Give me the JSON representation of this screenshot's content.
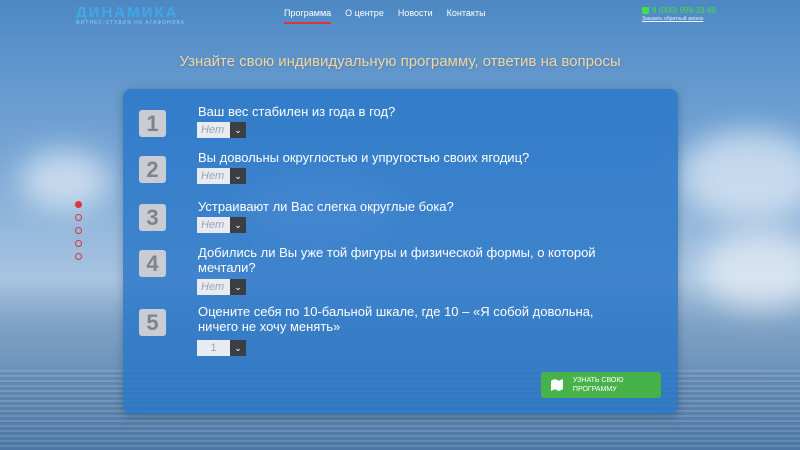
{
  "header": {
    "logo": {
      "title": "ДИНАМИКА",
      "subtitle": "ФИТНЕС-СТУДИЯ НА АГАФОНОВА"
    },
    "nav": [
      {
        "label": "Программа",
        "active": true
      },
      {
        "label": "О центре",
        "active": false
      },
      {
        "label": "Новости",
        "active": false
      },
      {
        "label": "Контакты",
        "active": false
      }
    ],
    "contact": {
      "phone": "8 (000) 999-33-88",
      "callback": "Заказать обратный звонок"
    }
  },
  "main": {
    "heading": "Узнайте свою индивидуальную программу, ответив на вопросы",
    "questions": [
      {
        "number": "1",
        "text": "Ваш вес стабилен из года в год?",
        "answer": "Нет"
      },
      {
        "number": "2",
        "text": "Вы довольны округлостью и упругостью своих ягодиц?",
        "answer": "Нет"
      },
      {
        "number": "3",
        "text": "Устраивают ли Вас слегка округлые бока?",
        "answer": "Нет"
      },
      {
        "number": "4",
        "text": "Добились ли Вы уже той фигуры и физической формы, о которой мечтали?",
        "answer": "Нет"
      },
      {
        "number": "5",
        "text": "Оцените себя по 10-бальной шкале, где 10 – «Я собой довольна, ничего не хочу менять»",
        "answer": "1"
      }
    ],
    "submit": {
      "label": "УЗНАТЬ СВОЮ ПРОГРАММУ",
      "icon": "map-icon"
    }
  },
  "slider": {
    "count": 5,
    "active": 1
  },
  "colors": {
    "accent": "#d9363e",
    "button": "#48b24a",
    "panel": "#2876c8",
    "heading": "#f2d6a2"
  }
}
